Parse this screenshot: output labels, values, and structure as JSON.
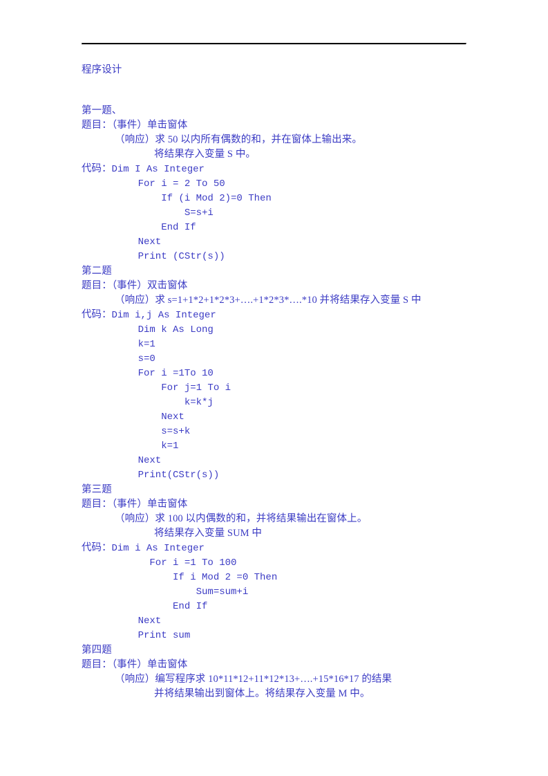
{
  "document": {
    "title": "程序设计",
    "text_color": "#3b3bc4",
    "rule_color": "#000000",
    "page_background": "#ffffff"
  },
  "sections": [
    {
      "heading": "第一题、",
      "prompt_label": "题目：",
      "event_line": "（事件）单击窗体",
      "response_lines": [
        "（响应）求 50 以内所有偶数的和，并在窗体上输出来。",
        "将结果存入变量 S 中。"
      ],
      "code_label": "代码：",
      "code_first": "Dim I As Integer",
      "code_lines": [
        "    For i = 2 To 50",
        "        If (i Mod 2)=0 Then",
        "            S=s+i",
        "        End If",
        "    Next",
        "    Print (CStr(s))"
      ]
    },
    {
      "heading": "第二题",
      "prompt_label": "题目：",
      "event_line": "（事件）双击窗体",
      "response_lines": [
        "（响应）求 s=1+1*2+1*2*3+….+1*2*3*….*10 并将结果存入变量 S 中"
      ],
      "code_label": "代码：",
      "code_first": "Dim i,j As Integer",
      "code_lines": [
        "    Dim k As Long",
        "    k=1",
        "    s=0",
        "    For i =1To 10",
        "        For j=1 To i",
        "            k=k*j",
        "        Next",
        "        s=s+k",
        "        k=1",
        "    Next",
        "    Print(CStr(s))"
      ]
    },
    {
      "heading": "第三题",
      "prompt_label": "题目：",
      "event_line": "（事件）单击窗体",
      "response_lines": [
        "（响应）求 100 以内偶数的和，并将结果输出在窗体上。",
        "将结果存入变量 SUM 中"
      ],
      "code_label": "代码：",
      "code_first": "Dim i As Integer",
      "code_lines": [
        "      For i =1 To 100",
        "          If i Mod 2 =0 Then",
        "              Sum=sum+i",
        "          End If",
        "    Next",
        "    Print sum"
      ]
    },
    {
      "heading": "第四题",
      "prompt_label": "题目：",
      "event_line": "（事件）单击窗体",
      "response_lines": [
        "（响应）编写程序求 10*11*12+11*12*13+….+15*16*17 的结果",
        "并将结果输出到窗体上。将结果存入变量 M 中。"
      ],
      "code_label": "",
      "code_first": "",
      "code_lines": []
    }
  ]
}
